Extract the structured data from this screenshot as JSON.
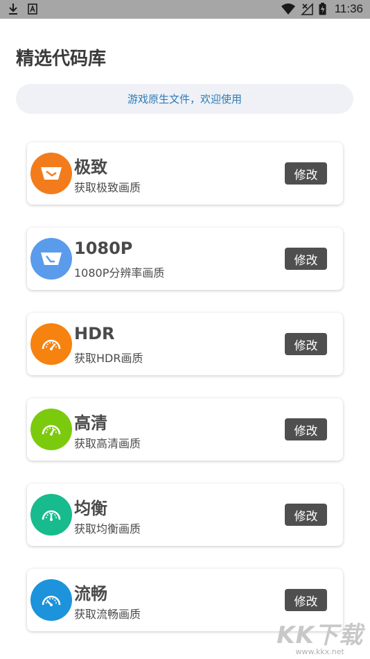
{
  "status_bar": {
    "time": "11:36"
  },
  "page": {
    "title": "精选代码库",
    "notice": "游戏原生文件，欢迎使用"
  },
  "cards": [
    {
      "name": "极致",
      "desc": "获取极致画质",
      "button": "修改",
      "color": "#f27c1b",
      "icon": "ratio-wide-icon"
    },
    {
      "name": "1080P",
      "desc": "1080P分辨率画质",
      "button": "修改",
      "color": "#5b9bec",
      "icon": "ratio-wide-icon"
    },
    {
      "name": "HDR",
      "desc": "获取HDR画质",
      "button": "修改",
      "color": "#f6820f",
      "icon": "speedometer-icon"
    },
    {
      "name": "高清",
      "desc": "获取高清画质",
      "button": "修改",
      "color": "#7cca0e",
      "icon": "speedometer-icon"
    },
    {
      "name": "均衡",
      "desc": "获取均衡画质",
      "button": "修改",
      "color": "#18bb8d",
      "icon": "speedometer-icon"
    },
    {
      "name": "流畅",
      "desc": "获取流畅画质",
      "button": "修改",
      "color": "#1c93da",
      "icon": "speedometer-icon"
    }
  ],
  "watermark": {
    "logo": "KK下载",
    "url": "www.kkx.net"
  }
}
